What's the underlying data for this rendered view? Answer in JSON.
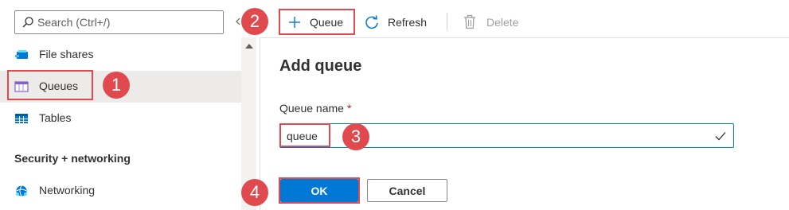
{
  "sidebar": {
    "search_placeholder": "Search (Ctrl+/)",
    "items": [
      {
        "label": "File shares",
        "icon": "file-shares-icon"
      },
      {
        "label": "Queues",
        "icon": "queues-icon",
        "selected": true
      },
      {
        "label": "Tables",
        "icon": "tables-icon"
      }
    ],
    "section_title": "Security + networking",
    "section_items": [
      {
        "label": "Networking",
        "icon": "networking-icon"
      }
    ]
  },
  "toolbar": {
    "add_queue_label": "Queue",
    "refresh_label": "Refresh",
    "delete_label": "Delete"
  },
  "panel": {
    "title": "Add queue",
    "field_label": "Queue name",
    "required_mark": "*",
    "field_value": "queue",
    "ok_label": "OK",
    "cancel_label": "Cancel"
  },
  "annotations": {
    "step1": "1",
    "step2": "2",
    "step3": "3",
    "step4": "4"
  },
  "colors": {
    "accent": "#0078d4",
    "annotation": "#e04a4f",
    "selected_bg": "#edebe9"
  }
}
